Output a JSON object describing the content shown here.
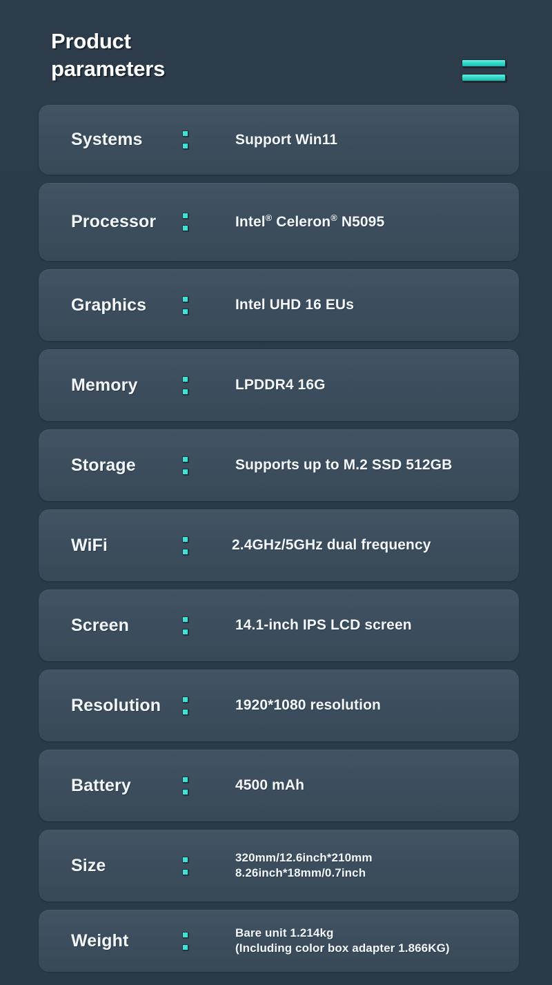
{
  "header": {
    "title": "Product\nparameters",
    "menu_icon": "hamburger-menu-icon"
  },
  "theme": {
    "background": "#2b3b49",
    "card": "#3e5060",
    "accent": "#3fe3d6",
    "text": "#f3f7f9"
  },
  "separator": ":",
  "rows": [
    {
      "label": "Systems",
      "value": "Support Win11"
    },
    {
      "label": "Processor",
      "value": "Intel® Celeron® N5095"
    },
    {
      "label": "Graphics",
      "value": "Intel UHD 16 EUs"
    },
    {
      "label": "Memory",
      "value": "LPDDR4 16G"
    },
    {
      "label": "Storage",
      "value": "Supports up to M.2 SSD 512GB"
    },
    {
      "label": "WiFi",
      "value": "2.4GHz/5GHz dual frequency"
    },
    {
      "label": "Screen",
      "value": "14.1-inch IPS LCD screen"
    },
    {
      "label": "Resolution",
      "value": "1920*1080 resolution"
    },
    {
      "label": "Battery",
      "value": "4500 mAh"
    },
    {
      "label": "Size",
      "value": "320mm/12.6inch*210mm\n8.26inch*18mm/0.7inch"
    },
    {
      "label": "Weight",
      "value": "Bare unit 1.214kg\n(Including color box adapter 1.866KG)"
    }
  ]
}
